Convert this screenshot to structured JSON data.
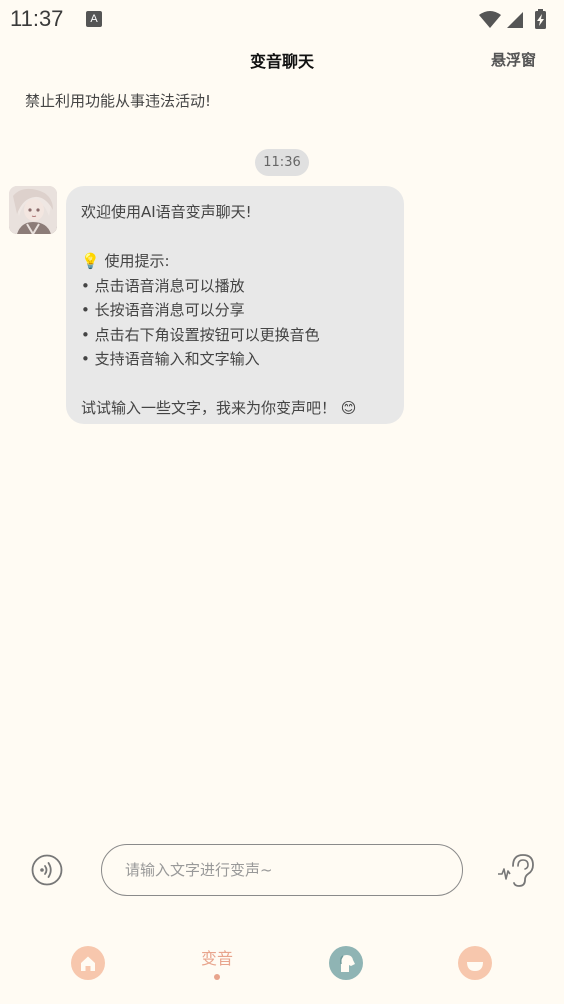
{
  "status_bar": {
    "time": "11:37",
    "notification_glyph": "A",
    "icons": [
      "wifi-icon",
      "cellular-signal-icon",
      "battery-charging-icon"
    ]
  },
  "header": {
    "title": "变音聊天",
    "right_action": "悬浮窗"
  },
  "notice": "禁止利用功能从事违法活动!",
  "chat": {
    "timestamp": "11:36",
    "message": {
      "line_1": "欢迎使用AI语音变声聊天!",
      "line_2": "💡 使用提示:",
      "line_3": "• 点击语音消息可以播放",
      "line_4": "• 长按语音消息可以分享",
      "line_5": "• 点击右下角设置按钮可以更换音色",
      "line_6": "• 支持语音输入和文字输入",
      "line_7": "试试输入一些文字，我来为你变声吧！ 😊"
    }
  },
  "input": {
    "placeholder": "请输入文字进行变声~",
    "value": ""
  },
  "tabs": [
    {
      "name": "home",
      "icon": "home-icon"
    },
    {
      "name": "voice-change",
      "label": "变音",
      "active": true
    },
    {
      "name": "pet",
      "icon": "dog-icon"
    },
    {
      "name": "profile",
      "icon": "smile-icon"
    }
  ],
  "colors": {
    "background": "#fffbf3",
    "accent": "#e8a48c",
    "bubble": "#e8e8e8",
    "tab_teal": "#8fb4b4"
  }
}
